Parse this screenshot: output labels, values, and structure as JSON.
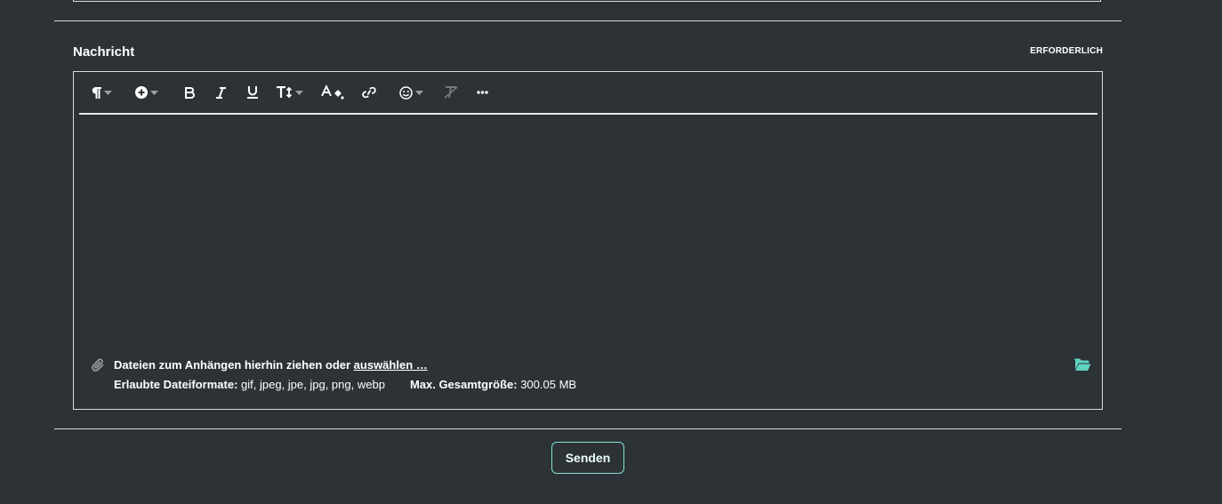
{
  "field": {
    "label": "Nachricht",
    "required_label": "ERFORDERLICH"
  },
  "toolbar": {
    "buttons": [
      {
        "name": "paragraph",
        "icon": "paragraph-icon",
        "has_dropdown": true
      },
      {
        "name": "insert",
        "icon": "plus-circle-icon",
        "has_dropdown": true
      },
      {
        "name": "bold",
        "icon": "bold-icon",
        "has_dropdown": false
      },
      {
        "name": "italic",
        "icon": "italic-icon",
        "has_dropdown": false
      },
      {
        "name": "underline",
        "icon": "underline-icon",
        "has_dropdown": false
      },
      {
        "name": "font-size",
        "icon": "text-size-icon",
        "has_dropdown": true
      },
      {
        "name": "text-color",
        "icon": "text-color-icon",
        "has_dropdown": false
      },
      {
        "name": "link",
        "icon": "link-icon",
        "has_dropdown": false
      },
      {
        "name": "emoji",
        "icon": "smiley-icon",
        "has_dropdown": true
      },
      {
        "name": "remove-format",
        "icon": "remove-format-icon",
        "has_dropdown": false,
        "disabled": true
      },
      {
        "name": "more",
        "icon": "more-icon",
        "has_dropdown": false
      }
    ]
  },
  "attachments": {
    "drop_text": "Dateien zum Anhängen hierhin ziehen oder ",
    "select_link": "auswählen …",
    "formats_label": "Erlaubte Dateiformate:",
    "formats_value": " gif, jpeg, jpe, jpg, png, webp",
    "max_size_label": "Max. Gesamtgröße:",
    "max_size_value": " 300.05 MB"
  },
  "submit": {
    "label": "Senden"
  },
  "colors": {
    "background": "#2d3236",
    "border": "#d8dde0",
    "accent": "#5fd3c1"
  }
}
